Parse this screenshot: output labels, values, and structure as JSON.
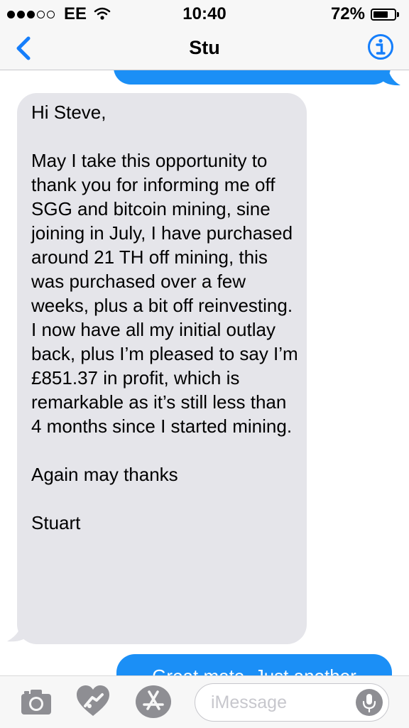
{
  "status_bar": {
    "carrier": "EE",
    "time": "10:40",
    "battery_percent": "72%",
    "battery_level": 0.72,
    "signal_bars": 3,
    "signal_bars_total": 5
  },
  "nav": {
    "back_icon": "chevron-left-icon",
    "title": "Stu",
    "info_icon": "info-icon",
    "accent_color": "#157efb"
  },
  "messages": {
    "received": {
      "text": "Hi Steve,\n\nMay I take this opportunity to thank you for informing me off SGG and bitcoin mining, sine joining in July, I have purchased around 21 TH off mining, this was purchased over a few weeks, plus a bit off reinvesting. I now have all my initial outlay back, plus I’m pleased to say I’m £851.37 in profit, which is remarkable as it’s still less than 4 months since I started mining.\n\nAgain may thanks\n\nStuart",
      "bubble_color": "#e5e5ea"
    },
    "sent_bottom": {
      "text": "Great mate. Just another",
      "bubble_color": "#1b8ff6"
    }
  },
  "input_bar": {
    "camera_icon": "camera-icon",
    "digital_touch_icon": "digital-touch-heart-icon",
    "app_store_icon": "app-store-icon",
    "placeholder": "iMessage",
    "mic_icon": "microphone-icon"
  }
}
